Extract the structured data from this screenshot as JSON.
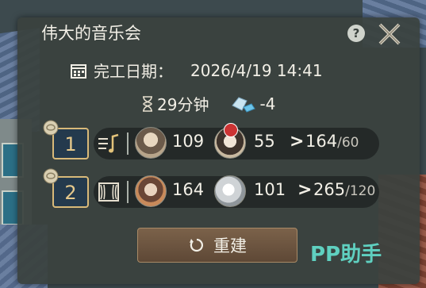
{
  "dialog": {
    "title": "伟大的音乐会",
    "help_label": "?",
    "finish_label": "完工日期：",
    "finish_time": "2026/4/19 14:41",
    "duration": "29分钟",
    "gem_cost": "-4"
  },
  "slots": [
    {
      "number": "1",
      "type_icon": "music-notes-icon",
      "worker_a_value": "109",
      "worker_b_value": "55",
      "arrow": ">",
      "total": "164",
      "max": "/60"
    },
    {
      "number": "2",
      "type_icon": "stage-curtain-icon",
      "worker_a_value": "164",
      "worker_b_value": "101",
      "arrow": ">",
      "total": "265",
      "max": "/120"
    }
  ],
  "rebuild_label": "重建",
  "watermark": "PP助手",
  "colors": {
    "panel": "#3a423e",
    "gold_border": "#d8b979",
    "number_bg": "#243a4d",
    "button": "#6b5440",
    "watermark": "#5fd0c0"
  }
}
